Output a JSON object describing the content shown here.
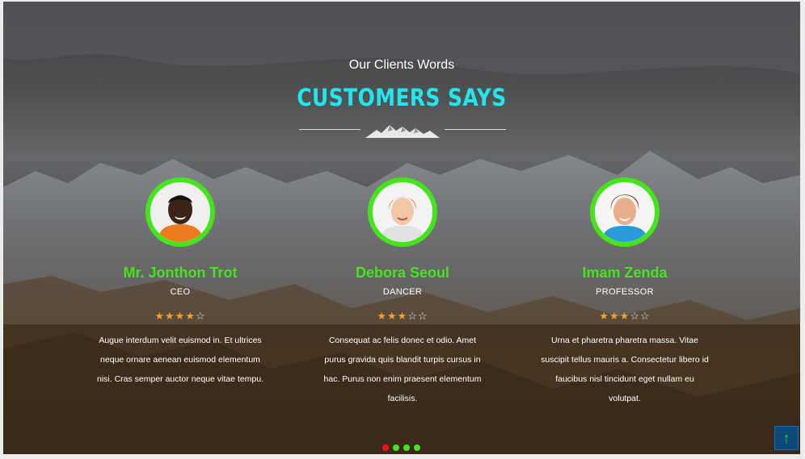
{
  "section": {
    "subtitle": "Our Clients Words",
    "title": "CUSTOMERS SAYS"
  },
  "testimonials": [
    {
      "name": "Mr. Jonthon Trot",
      "role": "CEO",
      "rating": 4,
      "quote": "Augue interdum velit euismod in. Et ultrices neque ornare aenean euismod elementum nisi. Cras semper auctor neque vitae tempu."
    },
    {
      "name": "Debora Seoul",
      "role": "DANCER",
      "rating": 3,
      "quote": "Consequat ac felis donec et odio. Amet purus gravida quis blandit turpis cursus in hac. Purus non enim praesent elementum facilisis."
    },
    {
      "name": "Imam Zenda",
      "role": "PROFESSOR",
      "rating": 3,
      "quote": "Urna et pharetra pharetra massa. Vitae suscipit tellus mauris a. Consectetur libero id faucibus nisl tincidunt eget nullam eu volutpat."
    }
  ],
  "pagination": {
    "count": 4,
    "active_index": 0
  },
  "icons": {
    "divider": "mountain-icon",
    "back_to_top": "arrow-up-icon"
  },
  "colors": {
    "accent_green": "#45e51b",
    "title_cyan": "#22e6ee",
    "star_filled": "#f0a030",
    "dot_active": "#ff1010",
    "dot_inactive": "#45e51b",
    "back_to_top_bg": "#0d4a7a"
  }
}
